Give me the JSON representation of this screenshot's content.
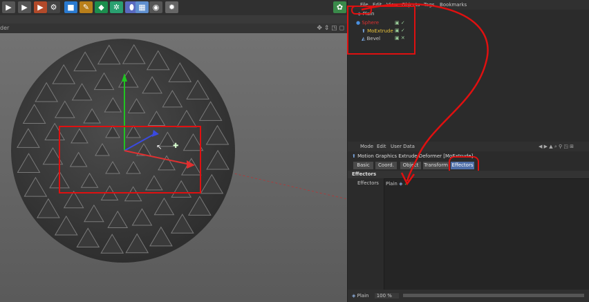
{
  "viewport": {
    "header_label": "der"
  },
  "object_manager": {
    "menu": [
      "File",
      "Edit",
      "View",
      "Objects",
      "Tags",
      "Bookmarks"
    ],
    "objects": [
      {
        "name": "Plain",
        "color": "#cfcfcf"
      },
      {
        "name": "Sphere",
        "color": "#e03030"
      },
      {
        "name": "MoExtrude",
        "color": "#e8c23a"
      },
      {
        "name": "Bevel",
        "color": "#cfcfcf"
      }
    ]
  },
  "attributes": {
    "menu": [
      "Mode",
      "Edit",
      "User Data"
    ],
    "title": "Motion Graphics Extrude Deformer [MoExtrude]",
    "tabs": [
      "Basic",
      "Coord.",
      "Object",
      "Transform",
      "Effectors"
    ],
    "section": "Effectors",
    "field_label": "Effectors",
    "effector_item": "Plain"
  },
  "status": {
    "label": "Plain",
    "value": "100 %"
  },
  "colors": {
    "annotation": "#e01010",
    "accent": "#4f6fa8"
  }
}
